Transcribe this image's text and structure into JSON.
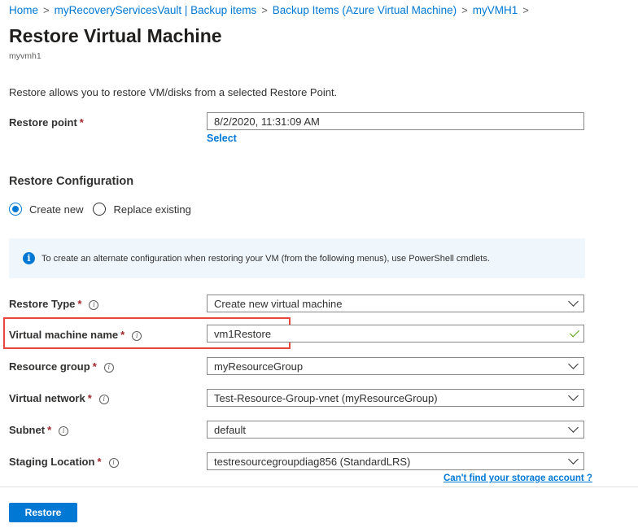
{
  "breadcrumb": [
    {
      "label": "Home"
    },
    {
      "label": "myRecoveryServicesVault | Backup items"
    },
    {
      "label": "Backup Items (Azure Virtual Machine)"
    },
    {
      "label": "myVMH1"
    }
  ],
  "page": {
    "title": "Restore Virtual Machine",
    "subtitle": "myvmh1",
    "intro": "Restore allows you to restore VM/disks from a selected Restore Point."
  },
  "restore_point": {
    "label": "Restore point",
    "value": "8/2/2020, 11:31:09 AM",
    "select_link": "Select"
  },
  "restore_configuration": {
    "heading": "Restore Configuration",
    "options": [
      {
        "label": "Create new",
        "selected": true
      },
      {
        "label": "Replace existing",
        "selected": false
      }
    ]
  },
  "info_banner": {
    "icon": "info-icon",
    "text": "To create an alternate configuration when restoring your VM (from the following menus), use PowerShell cmdlets."
  },
  "fields": {
    "restore_type": {
      "label": "Restore Type",
      "value": "Create new virtual machine"
    },
    "vm_name": {
      "label": "Virtual machine name",
      "value": "vm1Restore",
      "valid": true
    },
    "resource_group": {
      "label": "Resource group",
      "value": "myResourceGroup"
    },
    "virtual_network": {
      "label": "Virtual network",
      "value": "Test-Resource-Group-vnet (myResourceGroup)"
    },
    "subnet": {
      "label": "Subnet",
      "value": "default"
    },
    "staging_location": {
      "label": "Staging Location",
      "value": "testresourcegroupdiag856 (StandardLRS)"
    }
  },
  "required_marker": "*",
  "storage_link": "Can't find your storage account ?",
  "footer": {
    "restore_button": "Restore"
  },
  "colors": {
    "accent": "#0078d4",
    "highlight": "#e8473d",
    "required": "#a4262c",
    "valid": "#57a300"
  }
}
